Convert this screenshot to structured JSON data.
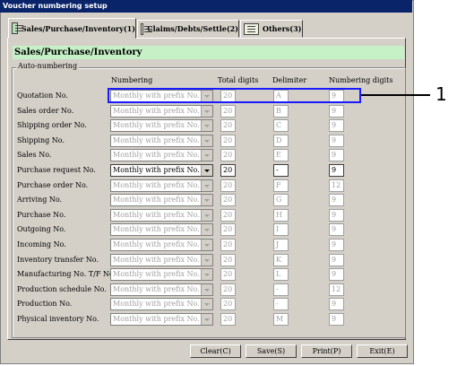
{
  "window": {
    "title": "Voucher numbering setup"
  },
  "tabs": [
    {
      "label": "Sales/Purchase/Inventory(1)",
      "icon": "book-icon",
      "active": true
    },
    {
      "label": "Claims/Debts/Settle(2)",
      "icon": "ledger-icon",
      "active": false
    },
    {
      "label": "Others(3)",
      "icon": "folder-icon",
      "active": false
    }
  ],
  "section_header": "Sales/Purchase/Inventory",
  "group_label": "Auto-numbering",
  "columns": {
    "numbering": "Numbering",
    "total_digits": "Total digits",
    "delimiter": "Delimiter",
    "numbering_digits": "Numbering digits"
  },
  "rows": [
    {
      "label": "Quotation No.",
      "numbering": "Monthly with prefix No.",
      "total": "20",
      "delim": "A",
      "digits": "9",
      "enabled": false
    },
    {
      "label": "Sales order No.",
      "numbering": "Monthly with prefix No.",
      "total": "20",
      "delim": "B",
      "digits": "9",
      "enabled": false
    },
    {
      "label": "Shipping order No.",
      "numbering": "Monthly with prefix No.",
      "total": "20",
      "delim": "C",
      "digits": "9",
      "enabled": false
    },
    {
      "label": "Shipping No.",
      "numbering": "Monthly with prefix No.",
      "total": "20",
      "delim": "D",
      "digits": "9",
      "enabled": false
    },
    {
      "label": "Sales No.",
      "numbering": "Monthly with prefix No.",
      "total": "20",
      "delim": "E",
      "digits": "9",
      "enabled": false
    },
    {
      "label": "Purchase request No.",
      "numbering": "Monthly with prefix No.",
      "total": "20",
      "delim": "-",
      "digits": "9",
      "enabled": true
    },
    {
      "label": "Purchase order No.",
      "numbering": "Monthly with prefix No.",
      "total": "20",
      "delim": "F",
      "digits": "12",
      "enabled": false
    },
    {
      "label": "Arriving No.",
      "numbering": "Monthly with prefix No.",
      "total": "20",
      "delim": "G",
      "digits": "9",
      "enabled": false
    },
    {
      "label": "Purchase No.",
      "numbering": "Monthly with prefix No.",
      "total": "20",
      "delim": "H",
      "digits": "9",
      "enabled": false
    },
    {
      "label": "Outgoing No.",
      "numbering": "Monthly with prefix No.",
      "total": "20",
      "delim": "I",
      "digits": "9",
      "enabled": false
    },
    {
      "label": "Incoming No.",
      "numbering": "Monthly with prefix No.",
      "total": "20",
      "delim": "J",
      "digits": "9",
      "enabled": false
    },
    {
      "label": "Inventory transfer No.",
      "numbering": "Monthly with prefix No.",
      "total": "20",
      "delim": "K",
      "digits": "9",
      "enabled": false
    },
    {
      "label": "Manufacturing No. T/F No.",
      "numbering": "Monthly with prefix No.",
      "total": "20",
      "delim": "L",
      "digits": "9",
      "enabled": false
    },
    {
      "label": "Production schedule No.",
      "numbering": "Monthly with prefix No.",
      "total": "20",
      "delim": "-",
      "digits": "12",
      "enabled": false
    },
    {
      "label": "Production No.",
      "numbering": "Monthly with prefix No.",
      "total": "20",
      "delim": "-",
      "digits": "9",
      "enabled": false
    },
    {
      "label": "Physical inventory No.",
      "numbering": "Monthly with prefix No.",
      "total": "20",
      "delim": "M",
      "digits": "9",
      "enabled": false
    }
  ],
  "buttons": {
    "clear": "Clear(C)",
    "save": "Save(S)",
    "print": "Print(P)",
    "exit": "Exit(E)"
  },
  "callout": {
    "number": "1",
    "color": "#1a1aff"
  }
}
